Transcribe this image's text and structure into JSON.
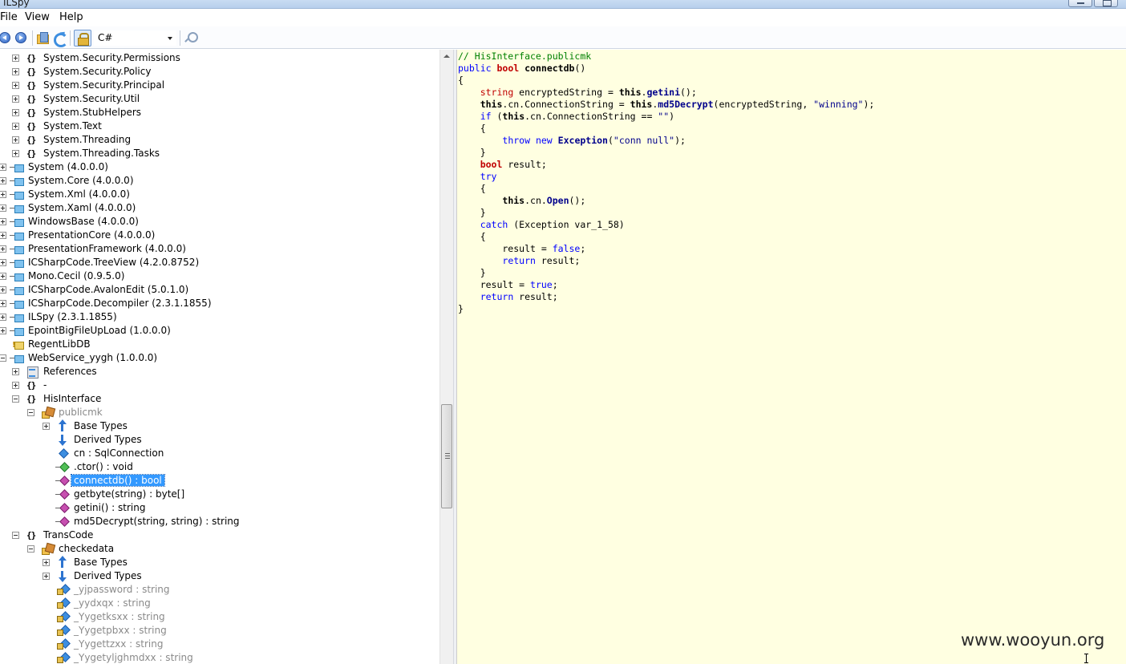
{
  "window": {
    "title": "ILSpy"
  },
  "menu": {
    "file": "File",
    "view": "View",
    "help": "Help"
  },
  "toolbar": {
    "language": "C#"
  },
  "tree": [
    {
      "indent": 1,
      "exp": "plus",
      "icon": "ns",
      "label": "System.Security.Permissions"
    },
    {
      "indent": 1,
      "exp": "plus",
      "icon": "ns",
      "label": "System.Security.Policy"
    },
    {
      "indent": 1,
      "exp": "plus",
      "icon": "ns",
      "label": "System.Security.Principal"
    },
    {
      "indent": 1,
      "exp": "plus",
      "icon": "ns",
      "label": "System.Security.Util"
    },
    {
      "indent": 1,
      "exp": "plus",
      "icon": "ns",
      "label": "System.StubHelpers"
    },
    {
      "indent": 1,
      "exp": "plus",
      "icon": "ns",
      "label": "System.Text"
    },
    {
      "indent": 1,
      "exp": "plus",
      "icon": "ns",
      "label": "System.Threading"
    },
    {
      "indent": 1,
      "exp": "plus",
      "icon": "ns",
      "label": "System.Threading.Tasks"
    },
    {
      "indent": 0,
      "exp": "plus",
      "icon": "asm",
      "label": "System (4.0.0.0)"
    },
    {
      "indent": 0,
      "exp": "plus",
      "icon": "asm",
      "label": "System.Core (4.0.0.0)"
    },
    {
      "indent": 0,
      "exp": "plus",
      "icon": "asm",
      "label": "System.Xml (4.0.0.0)"
    },
    {
      "indent": 0,
      "exp": "plus",
      "icon": "asm",
      "label": "System.Xaml (4.0.0.0)"
    },
    {
      "indent": 0,
      "exp": "plus",
      "icon": "asm",
      "label": "WindowsBase (4.0.0.0)"
    },
    {
      "indent": 0,
      "exp": "plus",
      "icon": "asm",
      "label": "PresentationCore (4.0.0.0)"
    },
    {
      "indent": 0,
      "exp": "plus",
      "icon": "asm",
      "label": "PresentationFramework (4.0.0.0)"
    },
    {
      "indent": 0,
      "exp": "plus",
      "icon": "asm",
      "label": "ICSharpCode.TreeView (4.2.0.8752)"
    },
    {
      "indent": 0,
      "exp": "plus",
      "icon": "asm",
      "label": "Mono.Cecil (0.9.5.0)"
    },
    {
      "indent": 0,
      "exp": "plus",
      "icon": "asm",
      "label": "ICSharpCode.AvalonEdit (5.0.1.0)"
    },
    {
      "indent": 0,
      "exp": "plus",
      "icon": "asm",
      "label": "ICSharpCode.Decompiler (2.3.1.1855)"
    },
    {
      "indent": 0,
      "exp": "plus",
      "icon": "asm",
      "label": "ILSpy (2.3.1.1855)"
    },
    {
      "indent": 0,
      "exp": "plus",
      "icon": "asm",
      "label": "EpointBigFileUpLoad (1.0.0.0)"
    },
    {
      "indent": 0,
      "exp": "none",
      "icon": "asmwarn",
      "label": "RegentLibDB"
    },
    {
      "indent": 0,
      "exp": "minus",
      "icon": "asm",
      "label": "WebService_yygh (1.0.0.0)"
    },
    {
      "indent": 1,
      "exp": "plus",
      "icon": "refs",
      "label": "References"
    },
    {
      "indent": 1,
      "exp": "plus",
      "icon": "ns",
      "label": "-"
    },
    {
      "indent": 1,
      "exp": "minus",
      "icon": "ns",
      "label": "HisInterface"
    },
    {
      "indent": 2,
      "exp": "minus",
      "icon": "class",
      "label": "publicmk",
      "gray": true
    },
    {
      "indent": 3,
      "exp": "plus",
      "icon": "base",
      "label": "Base Types"
    },
    {
      "indent": 3,
      "exp": "none",
      "icon": "derived",
      "label": "Derived Types"
    },
    {
      "indent": 3,
      "exp": "none",
      "icon": "field",
      "label": "cn : SqlConnection"
    },
    {
      "indent": 3,
      "exp": "none",
      "icon": "ctor",
      "label": ".ctor() : void"
    },
    {
      "indent": 3,
      "exp": "none",
      "icon": "method",
      "label": "connectdb() : bool",
      "selected": true
    },
    {
      "indent": 3,
      "exp": "none",
      "icon": "method",
      "label": "getbyte(string) : byte[]"
    },
    {
      "indent": 3,
      "exp": "none",
      "icon": "method",
      "label": "getini() : string"
    },
    {
      "indent": 3,
      "exp": "none",
      "icon": "method",
      "label": "md5Decrypt(string, string) : string"
    },
    {
      "indent": 1,
      "exp": "minus",
      "icon": "ns",
      "label": "TransCode"
    },
    {
      "indent": 2,
      "exp": "minus",
      "icon": "class",
      "label": "checkedata"
    },
    {
      "indent": 3,
      "exp": "plus",
      "icon": "base",
      "label": "Base Types"
    },
    {
      "indent": 3,
      "exp": "plus",
      "icon": "derived",
      "label": "Derived Types"
    },
    {
      "indent": 3,
      "exp": "none",
      "icon": "privfield",
      "label": "_yjpassword : string",
      "gray": true
    },
    {
      "indent": 3,
      "exp": "none",
      "icon": "privfield",
      "label": "_yydxqx : string",
      "gray": true
    },
    {
      "indent": 3,
      "exp": "none",
      "icon": "privfield",
      "label": "_Yygetksxx : string",
      "gray": true
    },
    {
      "indent": 3,
      "exp": "none",
      "icon": "privfield",
      "label": "_Yygetpbxx : string",
      "gray": true
    },
    {
      "indent": 3,
      "exp": "none",
      "icon": "privfield",
      "label": "_Yygettzxx : string",
      "gray": true
    },
    {
      "indent": 3,
      "exp": "none",
      "icon": "privfield",
      "label": "_Yygetyljghmdxx : string",
      "gray": true
    }
  ],
  "code": [
    [
      [
        "// HisInterface.publicmk",
        "comment"
      ]
    ],
    [
      [
        "public",
        "kw"
      ],
      [
        " ",
        ""
      ],
      [
        "bool",
        "type-b"
      ],
      [
        " ",
        ""
      ],
      [
        "connectdb",
        "bold"
      ],
      [
        "()",
        ""
      ]
    ],
    [
      [
        "{",
        ""
      ]
    ],
    [
      [
        "    ",
        ""
      ],
      [
        "string",
        "type"
      ],
      [
        " encryptedString = ",
        ""
      ],
      [
        "this",
        "bold"
      ],
      [
        ".",
        ""
      ],
      [
        "getini",
        "cls"
      ],
      [
        "();",
        ""
      ]
    ],
    [
      [
        "    ",
        ""
      ],
      [
        "this",
        "bold"
      ],
      [
        ".cn.ConnectionString = ",
        ""
      ],
      [
        "this",
        "bold"
      ],
      [
        ".",
        ""
      ],
      [
        "md5Decrypt",
        "cls"
      ],
      [
        "(encryptedString, ",
        ""
      ],
      [
        "\"winning\"",
        "str"
      ],
      [
        ");",
        ""
      ]
    ],
    [
      [
        "    ",
        ""
      ],
      [
        "if",
        "kw"
      ],
      [
        " (",
        ""
      ],
      [
        "this",
        "bold"
      ],
      [
        ".cn.ConnectionString == ",
        ""
      ],
      [
        "\"\"",
        "str"
      ],
      [
        ")",
        ""
      ]
    ],
    [
      [
        "    {",
        ""
      ]
    ],
    [
      [
        "        ",
        ""
      ],
      [
        "throw",
        "kw"
      ],
      [
        " ",
        ""
      ],
      [
        "new",
        "kw"
      ],
      [
        " ",
        ""
      ],
      [
        "Exception",
        "cls"
      ],
      [
        "(",
        ""
      ],
      [
        "\"conn null\"",
        "str"
      ],
      [
        ");",
        ""
      ]
    ],
    [
      [
        "    }",
        ""
      ]
    ],
    [
      [
        "    ",
        ""
      ],
      [
        "bool",
        "type-b"
      ],
      [
        " result;",
        ""
      ]
    ],
    [
      [
        "    ",
        ""
      ],
      [
        "try",
        "kw"
      ]
    ],
    [
      [
        "    {",
        ""
      ]
    ],
    [
      [
        "        ",
        ""
      ],
      [
        "this",
        "bold"
      ],
      [
        ".cn.",
        ""
      ],
      [
        "Open",
        "cls"
      ],
      [
        "();",
        ""
      ]
    ],
    [
      [
        "    }",
        ""
      ]
    ],
    [
      [
        "    ",
        ""
      ],
      [
        "catch",
        "kw"
      ],
      [
        " (Exception var_1_58)",
        ""
      ]
    ],
    [
      [
        "    {",
        ""
      ]
    ],
    [
      [
        "        result = ",
        ""
      ],
      [
        "false",
        "kw"
      ],
      [
        ";",
        ""
      ]
    ],
    [
      [
        "        ",
        ""
      ],
      [
        "return",
        "kw"
      ],
      [
        " result;",
        ""
      ]
    ],
    [
      [
        "    }",
        ""
      ]
    ],
    [
      [
        "    result = ",
        ""
      ],
      [
        "true",
        "kw"
      ],
      [
        ";",
        ""
      ]
    ],
    [
      [
        "    ",
        ""
      ],
      [
        "return",
        "kw"
      ],
      [
        " result;",
        ""
      ]
    ],
    [
      [
        "}",
        ""
      ]
    ]
  ],
  "watermark": "www.wooyun.org"
}
